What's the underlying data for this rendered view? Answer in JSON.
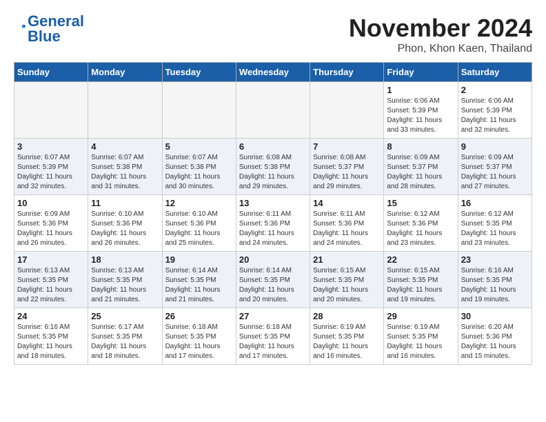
{
  "logo": {
    "line1": "General",
    "line2": "Blue"
  },
  "title": "November 2024",
  "location": "Phon, Khon Kaen, Thailand",
  "days_of_week": [
    "Sunday",
    "Monday",
    "Tuesday",
    "Wednesday",
    "Thursday",
    "Friday",
    "Saturday"
  ],
  "weeks": [
    [
      {
        "day": "",
        "info": ""
      },
      {
        "day": "",
        "info": ""
      },
      {
        "day": "",
        "info": ""
      },
      {
        "day": "",
        "info": ""
      },
      {
        "day": "",
        "info": ""
      },
      {
        "day": "1",
        "info": "Sunrise: 6:06 AM\nSunset: 5:39 PM\nDaylight: 11 hours\nand 33 minutes."
      },
      {
        "day": "2",
        "info": "Sunrise: 6:06 AM\nSunset: 5:39 PM\nDaylight: 11 hours\nand 32 minutes."
      }
    ],
    [
      {
        "day": "3",
        "info": "Sunrise: 6:07 AM\nSunset: 5:39 PM\nDaylight: 11 hours\nand 32 minutes."
      },
      {
        "day": "4",
        "info": "Sunrise: 6:07 AM\nSunset: 5:38 PM\nDaylight: 11 hours\nand 31 minutes."
      },
      {
        "day": "5",
        "info": "Sunrise: 6:07 AM\nSunset: 5:38 PM\nDaylight: 11 hours\nand 30 minutes."
      },
      {
        "day": "6",
        "info": "Sunrise: 6:08 AM\nSunset: 5:38 PM\nDaylight: 11 hours\nand 29 minutes."
      },
      {
        "day": "7",
        "info": "Sunrise: 6:08 AM\nSunset: 5:37 PM\nDaylight: 11 hours\nand 29 minutes."
      },
      {
        "day": "8",
        "info": "Sunrise: 6:09 AM\nSunset: 5:37 PM\nDaylight: 11 hours\nand 28 minutes."
      },
      {
        "day": "9",
        "info": "Sunrise: 6:09 AM\nSunset: 5:37 PM\nDaylight: 11 hours\nand 27 minutes."
      }
    ],
    [
      {
        "day": "10",
        "info": "Sunrise: 6:09 AM\nSunset: 5:36 PM\nDaylight: 11 hours\nand 26 minutes."
      },
      {
        "day": "11",
        "info": "Sunrise: 6:10 AM\nSunset: 5:36 PM\nDaylight: 11 hours\nand 26 minutes."
      },
      {
        "day": "12",
        "info": "Sunrise: 6:10 AM\nSunset: 5:36 PM\nDaylight: 11 hours\nand 25 minutes."
      },
      {
        "day": "13",
        "info": "Sunrise: 6:11 AM\nSunset: 5:36 PM\nDaylight: 11 hours\nand 24 minutes."
      },
      {
        "day": "14",
        "info": "Sunrise: 6:11 AM\nSunset: 5:36 PM\nDaylight: 11 hours\nand 24 minutes."
      },
      {
        "day": "15",
        "info": "Sunrise: 6:12 AM\nSunset: 5:36 PM\nDaylight: 11 hours\nand 23 minutes."
      },
      {
        "day": "16",
        "info": "Sunrise: 6:12 AM\nSunset: 5:35 PM\nDaylight: 11 hours\nand 23 minutes."
      }
    ],
    [
      {
        "day": "17",
        "info": "Sunrise: 6:13 AM\nSunset: 5:35 PM\nDaylight: 11 hours\nand 22 minutes."
      },
      {
        "day": "18",
        "info": "Sunrise: 6:13 AM\nSunset: 5:35 PM\nDaylight: 11 hours\nand 21 minutes."
      },
      {
        "day": "19",
        "info": "Sunrise: 6:14 AM\nSunset: 5:35 PM\nDaylight: 11 hours\nand 21 minutes."
      },
      {
        "day": "20",
        "info": "Sunrise: 6:14 AM\nSunset: 5:35 PM\nDaylight: 11 hours\nand 20 minutes."
      },
      {
        "day": "21",
        "info": "Sunrise: 6:15 AM\nSunset: 5:35 PM\nDaylight: 11 hours\nand 20 minutes."
      },
      {
        "day": "22",
        "info": "Sunrise: 6:15 AM\nSunset: 5:35 PM\nDaylight: 11 hours\nand 19 minutes."
      },
      {
        "day": "23",
        "info": "Sunrise: 6:16 AM\nSunset: 5:35 PM\nDaylight: 11 hours\nand 19 minutes."
      }
    ],
    [
      {
        "day": "24",
        "info": "Sunrise: 6:16 AM\nSunset: 5:35 PM\nDaylight: 11 hours\nand 18 minutes."
      },
      {
        "day": "25",
        "info": "Sunrise: 6:17 AM\nSunset: 5:35 PM\nDaylight: 11 hours\nand 18 minutes."
      },
      {
        "day": "26",
        "info": "Sunrise: 6:18 AM\nSunset: 5:35 PM\nDaylight: 11 hours\nand 17 minutes."
      },
      {
        "day": "27",
        "info": "Sunrise: 6:18 AM\nSunset: 5:35 PM\nDaylight: 11 hours\nand 17 minutes."
      },
      {
        "day": "28",
        "info": "Sunrise: 6:19 AM\nSunset: 5:35 PM\nDaylight: 11 hours\nand 16 minutes."
      },
      {
        "day": "29",
        "info": "Sunrise: 6:19 AM\nSunset: 5:35 PM\nDaylight: 11 hours\nand 16 minutes."
      },
      {
        "day": "30",
        "info": "Sunrise: 6:20 AM\nSunset: 5:36 PM\nDaylight: 11 hours\nand 15 minutes."
      }
    ]
  ]
}
